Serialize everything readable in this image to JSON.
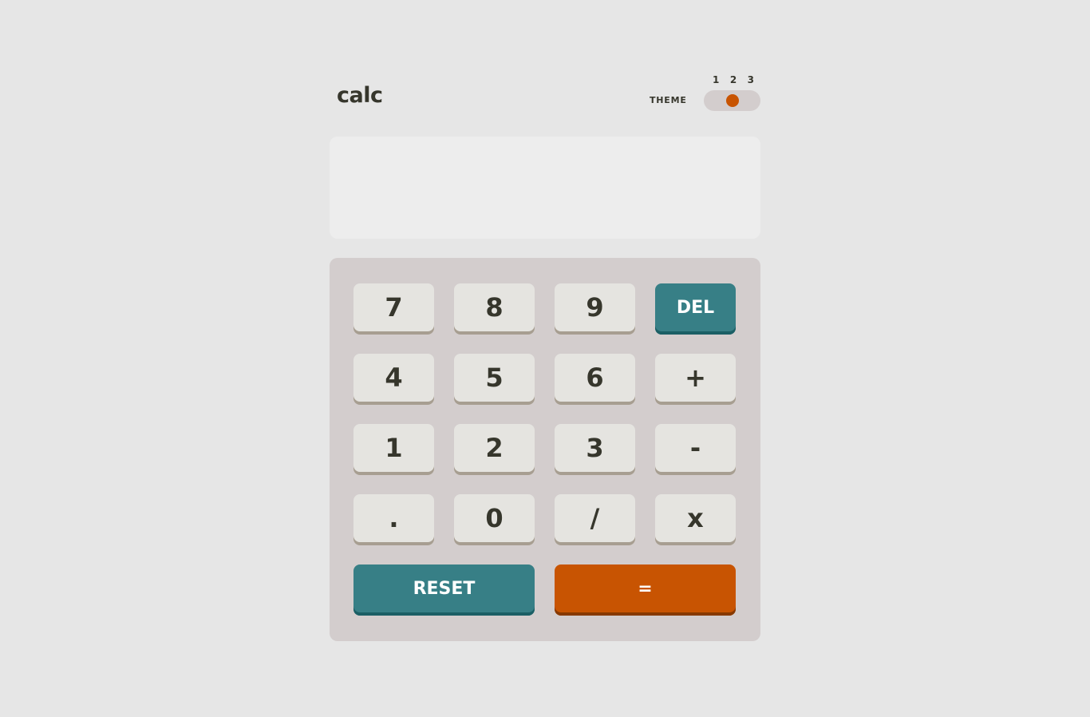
{
  "header": {
    "logo": "calc",
    "theme_label": "THEME",
    "theme_options": [
      "1",
      "2",
      "3"
    ],
    "active_theme": 2
  },
  "display": {
    "value": ""
  },
  "keys": {
    "seven": "7",
    "eight": "8",
    "nine": "9",
    "del": "DEL",
    "four": "4",
    "five": "5",
    "six": "6",
    "plus": "+",
    "one": "1",
    "two": "2",
    "three": "3",
    "minus": "-",
    "dot": ".",
    "zero": "0",
    "divide": "/",
    "multiply": "x",
    "reset": "RESET",
    "equals": "="
  },
  "colors": {
    "page_bg": "#e6e6e6",
    "accent_teal": "#377f86",
    "accent_orange": "#c85402",
    "key_bg": "#e5e4e0",
    "text": "#36362c"
  }
}
